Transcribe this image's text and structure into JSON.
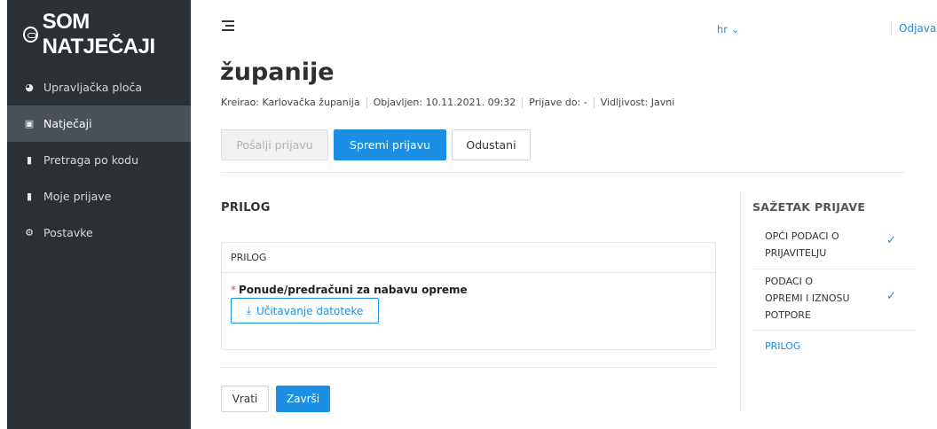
{
  "brand": {
    "name": "SOM NATJEČAJI"
  },
  "sidebar": {
    "items": [
      {
        "label": "Upravljačka ploča",
        "icon": "dashboard-icon"
      },
      {
        "label": "Natječaji",
        "icon": "folder-icon",
        "active": true
      },
      {
        "label": "Pretraga po kodu",
        "icon": "document-icon"
      },
      {
        "label": "Moje prijave",
        "icon": "document-icon"
      },
      {
        "label": "Postavke",
        "icon": "gear-icon"
      }
    ]
  },
  "topbar": {
    "language": "hr",
    "logout": "Odjava"
  },
  "page": {
    "title": "županije",
    "meta": {
      "created_by": "Kreirao: Karlovačka županija",
      "published": "Objavljen: 10.11.2021. 09:32",
      "deadline": "Prijave do: -",
      "visibility": "Vidljivost: Javni"
    }
  },
  "actions": {
    "send": "Pošalji prijavu",
    "save": "Spremi prijavu",
    "cancel": "Odustani"
  },
  "form": {
    "section_title": "PRILOG",
    "card_title": "PRILOG",
    "field_label": "Ponude/predračuni za nabavu opreme",
    "required_mark": "*",
    "upload_label": "Učitavanje datoteke"
  },
  "footer_actions": {
    "back": "Vrati",
    "finish": "Završi"
  },
  "summary": {
    "title": "SAŽETAK PRIJAVE",
    "items": [
      {
        "lines": [
          "OPĆI PODACI O",
          "PRIJAVITELJU"
        ],
        "done": true
      },
      {
        "lines": [
          "PODACI O",
          "OPREMI I IZNOSU",
          "POTPORE"
        ],
        "done": true
      },
      {
        "lines": [
          "PRILOG"
        ],
        "done": false,
        "active": true
      }
    ]
  },
  "colors": {
    "accent": "#1a8fe3",
    "sidebar": "#2b3035",
    "sidebar_active": "#4a5158",
    "required": "#e0474c"
  }
}
